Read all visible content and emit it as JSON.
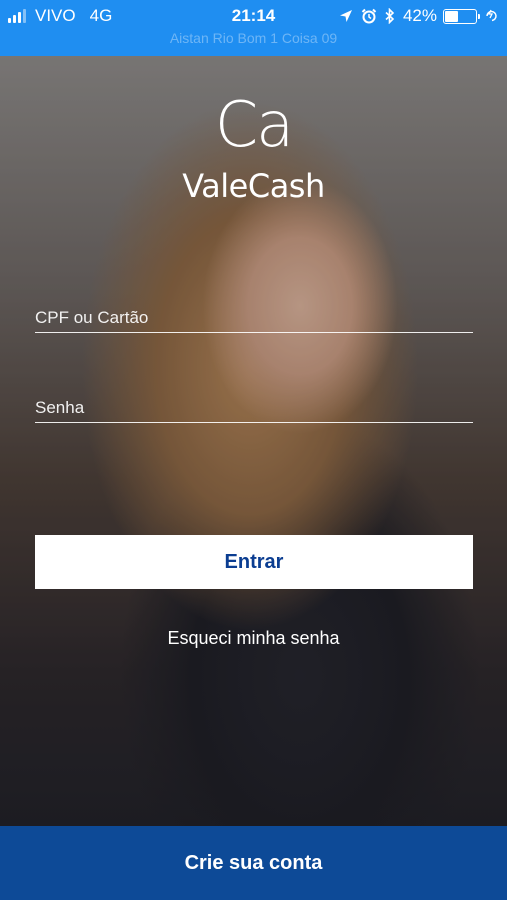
{
  "status_bar": {
    "carrier": "VIVO",
    "network": "4G",
    "time": "21:14",
    "battery_percent": "42%",
    "battery_level": 0.42,
    "subtitle": "Aistan Rio Bom 1 Coisa 09",
    "icons": [
      "signal-icon",
      "location-icon",
      "alarm-icon",
      "bluetooth-icon",
      "battery-icon",
      "charging-icon"
    ],
    "color": "#1f8ef1"
  },
  "logo": {
    "mark": "Ca",
    "name": "ValeCash"
  },
  "login": {
    "cpf_placeholder": "CPF ou Cartão",
    "cpf_value": "",
    "password_placeholder": "Senha",
    "password_value": "",
    "submit_label": "Entrar",
    "forgot_label": "Esqueci minha senha"
  },
  "footer": {
    "create_account_label": "Crie sua conta",
    "color": "#0d4a97"
  },
  "colors": {
    "primary": "#0b3d91",
    "status_bar": "#1f8ef1"
  }
}
